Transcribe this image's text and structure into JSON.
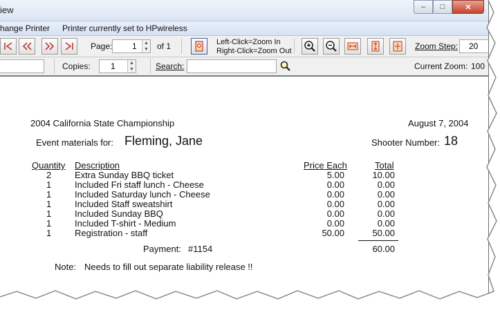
{
  "window": {
    "title": "iew"
  },
  "menubar": {
    "change_printer": "hange Printer",
    "printer_status": "Printer currently set to HPwireless"
  },
  "toolbar": {
    "page_label": "Page:",
    "page_value": "1",
    "of_pages": "of 1",
    "zoom_hint_line1": "Left-Click=Zoom In",
    "zoom_hint_line2": "Right-Click=Zoom Out",
    "zoom_step_label": "Zoom Step:",
    "zoom_step_value": "20",
    "copies_label": "Copies:",
    "copies_value": "1",
    "search_label": "Search:",
    "search_value": "",
    "current_zoom_label": "Current Zoom:",
    "current_zoom_value": "100"
  },
  "report": {
    "event": "2004 California State Championship",
    "date": "August  7, 2004",
    "materials_label": "Event materials for:",
    "shooter_name": "Fleming, Jane",
    "shooter_number_label": "Shooter Number:",
    "shooter_number": "18",
    "headers": {
      "quantity": "Quantity",
      "description": "Description",
      "price_each": "Price Each",
      "total": "Total"
    },
    "items": [
      {
        "qty": "2",
        "desc": "Extra Sunday BBQ ticket",
        "price": "5.00",
        "total": "10.00"
      },
      {
        "qty": "1",
        "desc": "Included Fri staff lunch - Cheese",
        "price": "0.00",
        "total": "0.00"
      },
      {
        "qty": "1",
        "desc": "Included Saturday lunch - Cheese",
        "price": "0.00",
        "total": "0.00"
      },
      {
        "qty": "1",
        "desc": "Included Staff sweatshirt",
        "price": "0.00",
        "total": "0.00"
      },
      {
        "qty": "1",
        "desc": "Included Sunday BBQ",
        "price": "0.00",
        "total": "0.00"
      },
      {
        "qty": "1",
        "desc": "Included T-shirt - Medium",
        "price": "0.00",
        "total": "0.00"
      },
      {
        "qty": "1",
        "desc": "Registration - staff",
        "price": "50.00",
        "total": "50.00"
      }
    ],
    "payment_label": "Payment:",
    "payment_ref": "#1154",
    "grand_total": "60.00",
    "note_label": "Note:",
    "note_text": "Needs to fill out separate liability release !!"
  }
}
